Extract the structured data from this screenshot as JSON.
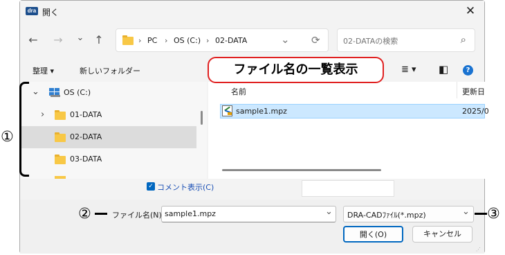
{
  "window": {
    "app_tag": "dra",
    "title": "開く",
    "close_glyph": "✕"
  },
  "nav": {
    "back": "←",
    "forward": "→",
    "recent": "⌄",
    "up": "↑"
  },
  "address": {
    "sep": "›",
    "items": [
      "PC",
      "OS (C:)",
      "02-DATA"
    ],
    "refresh": "⟳"
  },
  "search": {
    "placeholder": "02-DATAの検索",
    "icon": "⌕"
  },
  "toolbar": {
    "organize": "整理 ▾",
    "new_folder": "新しいフォルダー",
    "view_icon": "≣ ▾",
    "pane_icon": "◧",
    "help_icon": "?"
  },
  "callout": "ファイル名の一覧表示",
  "tree": [
    {
      "label": "OS (C:)",
      "expander": "⌄"
    },
    {
      "label": "01-DATA",
      "expander": "›"
    },
    {
      "label": "02-DATA",
      "expander": ""
    },
    {
      "label": "03-DATA",
      "expander": ""
    }
  ],
  "file_list": {
    "columns": [
      "名前",
      "更新日"
    ],
    "rows": [
      {
        "name": "sample1.mpz",
        "date": "2025/0"
      }
    ]
  },
  "comment": {
    "checked": true,
    "check_glyph": "✓",
    "label": "コメント表示(C)"
  },
  "filename": {
    "label": "ファイル名(N):",
    "value": "sample1.mpz",
    "chevron": "⌄"
  },
  "filetype": {
    "value": "DRA-CADﾌｧｲﾙ(*.mpz)",
    "chevron": "⌄"
  },
  "buttons": {
    "open": "開く(O)",
    "cancel": "キャンセル"
  },
  "annotations": {
    "one": "①",
    "two": "②",
    "three": "③"
  },
  "colors": {
    "callout_border": "#e02020",
    "selection": "#cce8ff",
    "accent": "#0067c0",
    "help": "#1a73d1"
  }
}
